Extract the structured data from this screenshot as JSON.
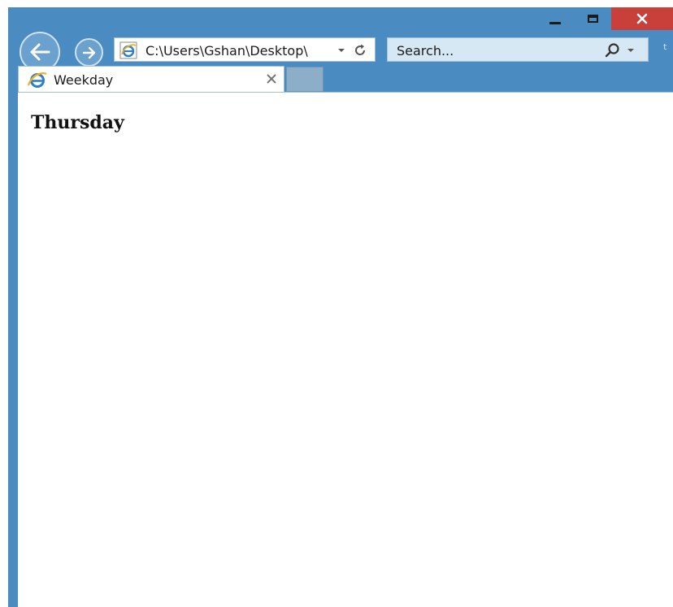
{
  "window": {
    "controls": {
      "minimize_icon": "minimize-icon",
      "maximize_icon": "maximize-icon",
      "close_icon": "close-icon"
    }
  },
  "toolbar": {
    "back_icon": "back-arrow-icon",
    "forward_icon": "forward-arrow-icon",
    "address": "C:\\Users\\Gshan\\Desktop\\",
    "search_placeholder": "Search..."
  },
  "tab": {
    "label": "Weekday"
  },
  "page": {
    "text": "Thursday"
  },
  "colors": {
    "frame": "#4a8cc2",
    "close_button": "#c9403b",
    "search_box": "#d7e8f5",
    "new_tab": "#8caec9",
    "content": "#ffffff"
  }
}
